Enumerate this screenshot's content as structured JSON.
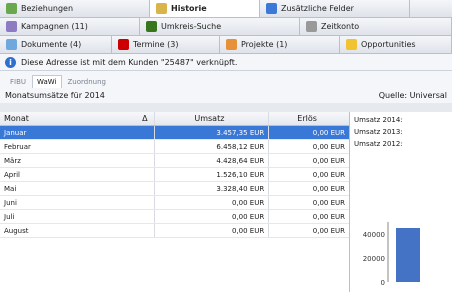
{
  "tabs_row1": [
    {
      "label": "Beziehungen",
      "icon": "people-icon",
      "color": "#6aa84f",
      "active": false
    },
    {
      "label": "Historie",
      "icon": "history-icon",
      "color": "#d9b44a",
      "active": true
    },
    {
      "label": "Zusätzliche Felder",
      "icon": "pencil-icon",
      "color": "#3c78d8",
      "active": false
    }
  ],
  "tabs_row2": [
    {
      "label": "Kampagnen (11)",
      "icon": "campaign-icon",
      "color": "#8e7cc3",
      "active": false
    },
    {
      "label": "Umkreis-Suche",
      "icon": "radar-icon",
      "color": "#38761d",
      "active": false
    },
    {
      "label": "Zeitkonto",
      "icon": "clock-icon",
      "color": "#999999",
      "active": false
    }
  ],
  "tabs_row3": [
    {
      "label": "Dokumente (4)",
      "icon": "document-icon",
      "color": "#6fa8dc",
      "active": false
    },
    {
      "label": "Termine (3)",
      "icon": "calendar-icon",
      "color": "#cc0000",
      "active": false
    },
    {
      "label": "Projekte (1)",
      "icon": "folder-icon",
      "color": "#e69138",
      "active": false
    },
    {
      "label": "Opportunities",
      "icon": "heart-icon",
      "color": "#f1c232",
      "active": false
    }
  ],
  "info": {
    "text": "Diese Adresse ist mit dem Kunden \"25487\" verknüpft."
  },
  "subtabs": [
    {
      "label": "FIBU",
      "active": false
    },
    {
      "label": "WaWi",
      "active": true
    },
    {
      "label": "Zuordnung",
      "active": false
    }
  ],
  "section": {
    "title": "Monatsumsätze für 2014",
    "source": "Quelle: Universal"
  },
  "table": {
    "columns": [
      "Monat",
      "Umsatz",
      "Erlös"
    ],
    "sort_indicator": "Δ",
    "rows": [
      {
        "month": "Januar",
        "umsatz": "3.457,35 EUR",
        "erloes": "0,00 EUR",
        "selected": true
      },
      {
        "month": "Februar",
        "umsatz": "6.458,12 EUR",
        "erloes": "0,00 EUR",
        "selected": false
      },
      {
        "month": "März",
        "umsatz": "4.428,64 EUR",
        "erloes": "0,00 EUR",
        "selected": false
      },
      {
        "month": "April",
        "umsatz": "1.526,10 EUR",
        "erloes": "0,00 EUR",
        "selected": false
      },
      {
        "month": "Mai",
        "umsatz": "3.328,40 EUR",
        "erloes": "0,00 EUR",
        "selected": false
      },
      {
        "month": "Juni",
        "umsatz": "0,00 EUR",
        "erloes": "0,00 EUR",
        "selected": false
      },
      {
        "month": "Juli",
        "umsatz": "0,00 EUR",
        "erloes": "0,00 EUR",
        "selected": false
      },
      {
        "month": "August",
        "umsatz": "0,00 EUR",
        "erloes": "0,00 EUR",
        "selected": false
      }
    ]
  },
  "side": {
    "lines": [
      "Umsatz 2014:",
      "Umsatz 2013:",
      "Umsatz 2012:"
    ]
  },
  "chart_data": {
    "type": "bar",
    "ylim": [
      0,
      50000
    ],
    "yticks": [
      40000,
      20000,
      0
    ],
    "values": [
      45000
    ],
    "color": "#4472c4"
  }
}
